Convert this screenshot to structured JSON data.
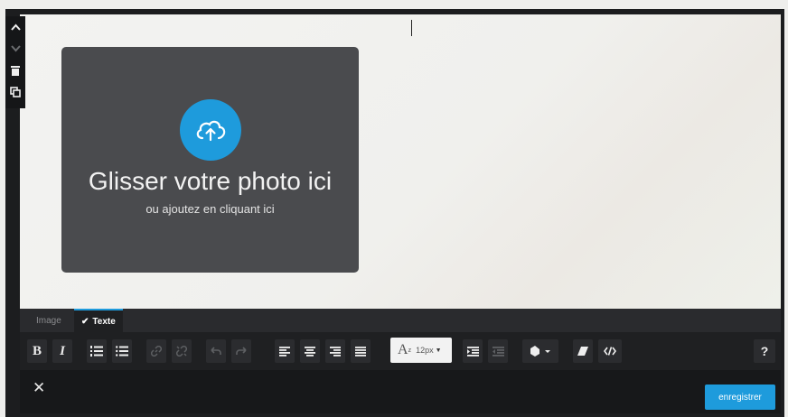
{
  "upload": {
    "title": "Glisser votre photo ici",
    "subtitle": "ou ajoutez en cliquant ici",
    "icon": "cloud-upload-icon",
    "accent": "#1e9bdc"
  },
  "side_tools": {
    "icons": [
      "chevron-up-icon",
      "chevron-down-icon",
      "trash-icon",
      "duplicate-icon"
    ]
  },
  "tabs": [
    {
      "label": "Image",
      "active": false
    },
    {
      "label": "Texte",
      "active": true
    }
  ],
  "toolbar": {
    "bold": "B",
    "italic": "I",
    "font_size_glyph": "A",
    "font_size_sup": "z",
    "font_size_value": "12px",
    "help": "?",
    "icons": [
      "bold-icon",
      "italic-icon",
      "ordered-list-icon",
      "unordered-list-icon",
      "link-icon",
      "unlink-icon",
      "undo-icon",
      "redo-icon",
      "align-left-icon",
      "align-center-icon",
      "align-right-icon",
      "align-justify-icon",
      "font-size-icon",
      "indent-icon",
      "outdent-icon",
      "color-fill-icon",
      "eraser-icon",
      "code-icon",
      "help-icon"
    ]
  },
  "footer": {
    "close": "✕",
    "save_label": "enregistrer",
    "save_color": "#1e9bdc"
  }
}
